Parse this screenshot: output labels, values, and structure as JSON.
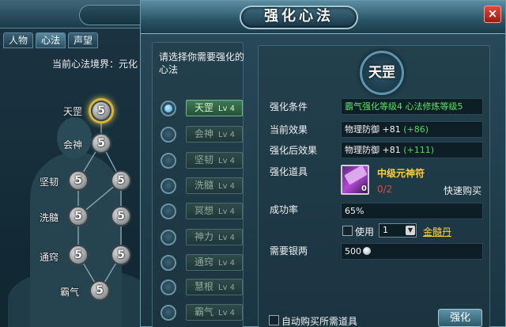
{
  "character_window": {
    "tabs": [
      "人物",
      "心法",
      "声望"
    ],
    "active_tab": 1,
    "realm_label": "当前心法境界：元化",
    "nodes": [
      {
        "label": "天罡",
        "level": "5"
      },
      {
        "label": "会神",
        "level": "5"
      },
      {
        "label": "坚韧",
        "level": "5"
      },
      {
        "label": "",
        "level": "5"
      },
      {
        "label": "洗髓",
        "level": "5"
      },
      {
        "label": "",
        "level": "5"
      },
      {
        "label": "通窍",
        "level": "5"
      },
      {
        "label": "",
        "level": "5"
      },
      {
        "label": "霸气",
        "level": "5"
      }
    ]
  },
  "dialog": {
    "title": "强化心法",
    "close_label": "×",
    "prompt": "请选择你需要强化的心法",
    "list": [
      {
        "name": "天罡",
        "level": "Lv 4",
        "selected": true
      },
      {
        "name": "会神",
        "level": "Lv 4",
        "selected": false
      },
      {
        "name": "坚韧",
        "level": "Lv 4",
        "selected": false
      },
      {
        "name": "洗髓",
        "level": "Lv 4",
        "selected": false
      },
      {
        "name": "冥想",
        "level": "Lv 4",
        "selected": false
      },
      {
        "name": "神力",
        "level": "Lv 4",
        "selected": false
      },
      {
        "name": "通窍",
        "level": "Lv 4",
        "selected": false
      },
      {
        "name": "慧根",
        "level": "Lv 4",
        "selected": false
      },
      {
        "name": "霸气",
        "level": "Lv 4",
        "selected": false
      }
    ],
    "detail": {
      "emblem": "天罡",
      "condition_label": "强化条件",
      "condition_value": "霸气强化等级4  心法修炼等级5",
      "current_label": "当前效果",
      "current_stat": "物理防御 +81",
      "current_bonus": "(+86)",
      "after_label": "强化后效果",
      "after_stat": "物理防御 +81",
      "after_bonus": "(+111)",
      "item_label": "强化道具",
      "item_name": "中级元神符",
      "item_count": "0",
      "item_qty": "0/2",
      "buy_label": "快速购买",
      "rate_label": "成功率",
      "rate_value": "65%",
      "use_label": "使用",
      "use_count": "1",
      "use_item_link": "金髓丹",
      "silver_label": "需要银两",
      "silver_value": "500"
    },
    "autobuy_label": "自动购买所需道具",
    "strengthen_label": "强化"
  }
}
